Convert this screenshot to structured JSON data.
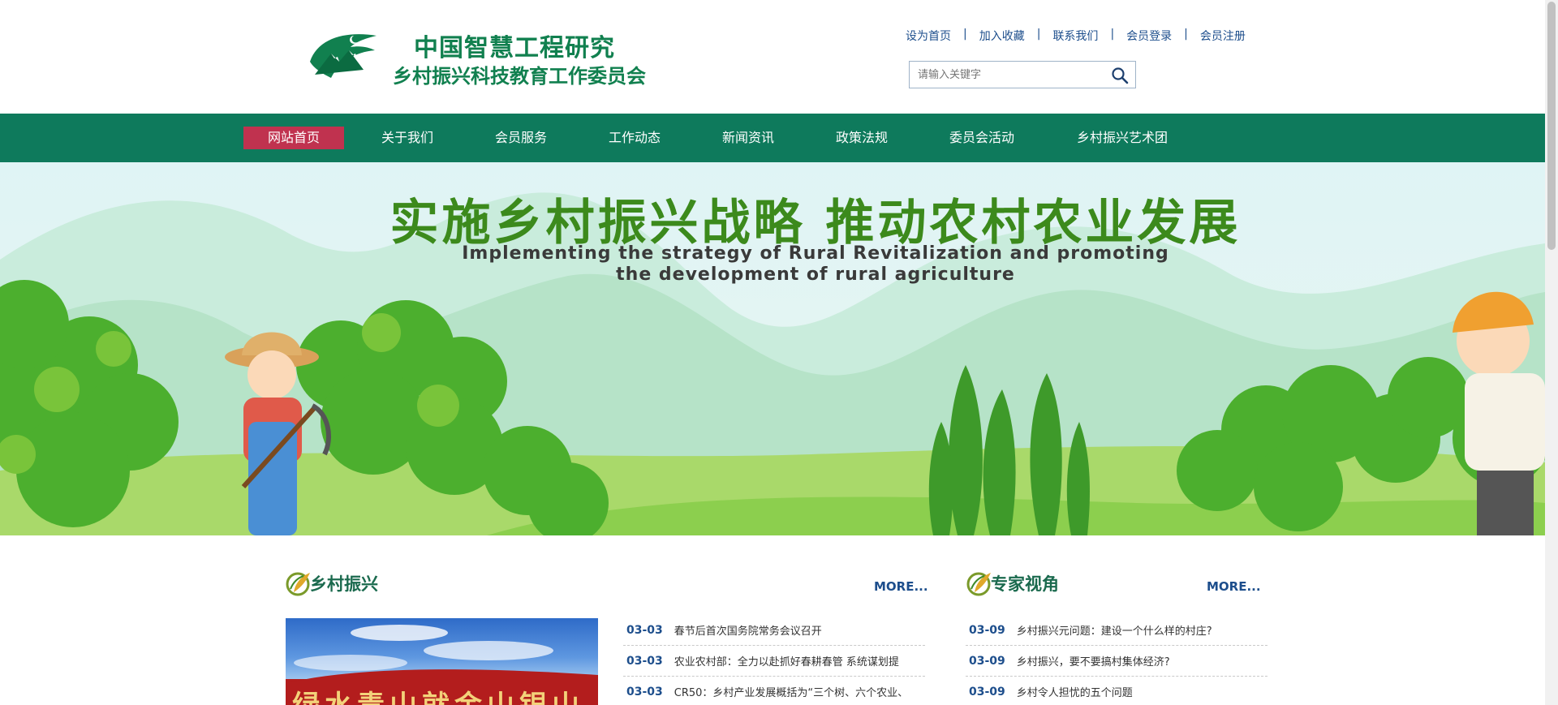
{
  "header": {
    "logo_line1": "中国智慧工程研究",
    "logo_line2": "乡村振兴科技教育工作委员会",
    "top_links": [
      "设为首页",
      "加入收藏",
      "联系我们",
      "会员登录",
      "会员注册"
    ],
    "separator": "|",
    "search_placeholder": "请输入关键字",
    "search_icon": "search-icon"
  },
  "nav": {
    "items": [
      "网站首页",
      "关于我们",
      "会员服务",
      "工作动态",
      "新闻资讯",
      "政策法规",
      "委员会活动",
      "乡村振兴艺术团"
    ],
    "active_index": 0
  },
  "banner": {
    "title": "实施乡村振兴战略  推动农村农业发展",
    "subtitle": "Implementing the strategy of Rural Revitalization and promoting the development of rural agriculture"
  },
  "sections": {
    "rural": {
      "title": "乡村振兴",
      "more": "MORE...",
      "image_text": "绿水青山就金山银山",
      "news": [
        {
          "date": "03-03",
          "text": "春节后首次国务院常务会议召开"
        },
        {
          "date": "03-03",
          "text": "农业农村部：全力以赴抓好春耕春管 系统谋划提"
        },
        {
          "date": "03-03",
          "text": "CR50：乡村产业发展概括为“三个树、六个农业、"
        }
      ]
    },
    "expert": {
      "title": "专家视角",
      "more": "MORE...",
      "news": [
        {
          "date": "03-09",
          "text": "乡村振兴元问题：建设一个什么样的村庄?"
        },
        {
          "date": "03-09",
          "text": "乡村振兴，要不要搞村集体经济?"
        },
        {
          "date": "03-09",
          "text": "乡村令人担忧的五个问题"
        }
      ]
    }
  },
  "colors": {
    "brand_green": "#11804f",
    "nav_bg": "#0e7a5c",
    "nav_active": "#c0324f",
    "link_blue": "#1d4e8c"
  }
}
